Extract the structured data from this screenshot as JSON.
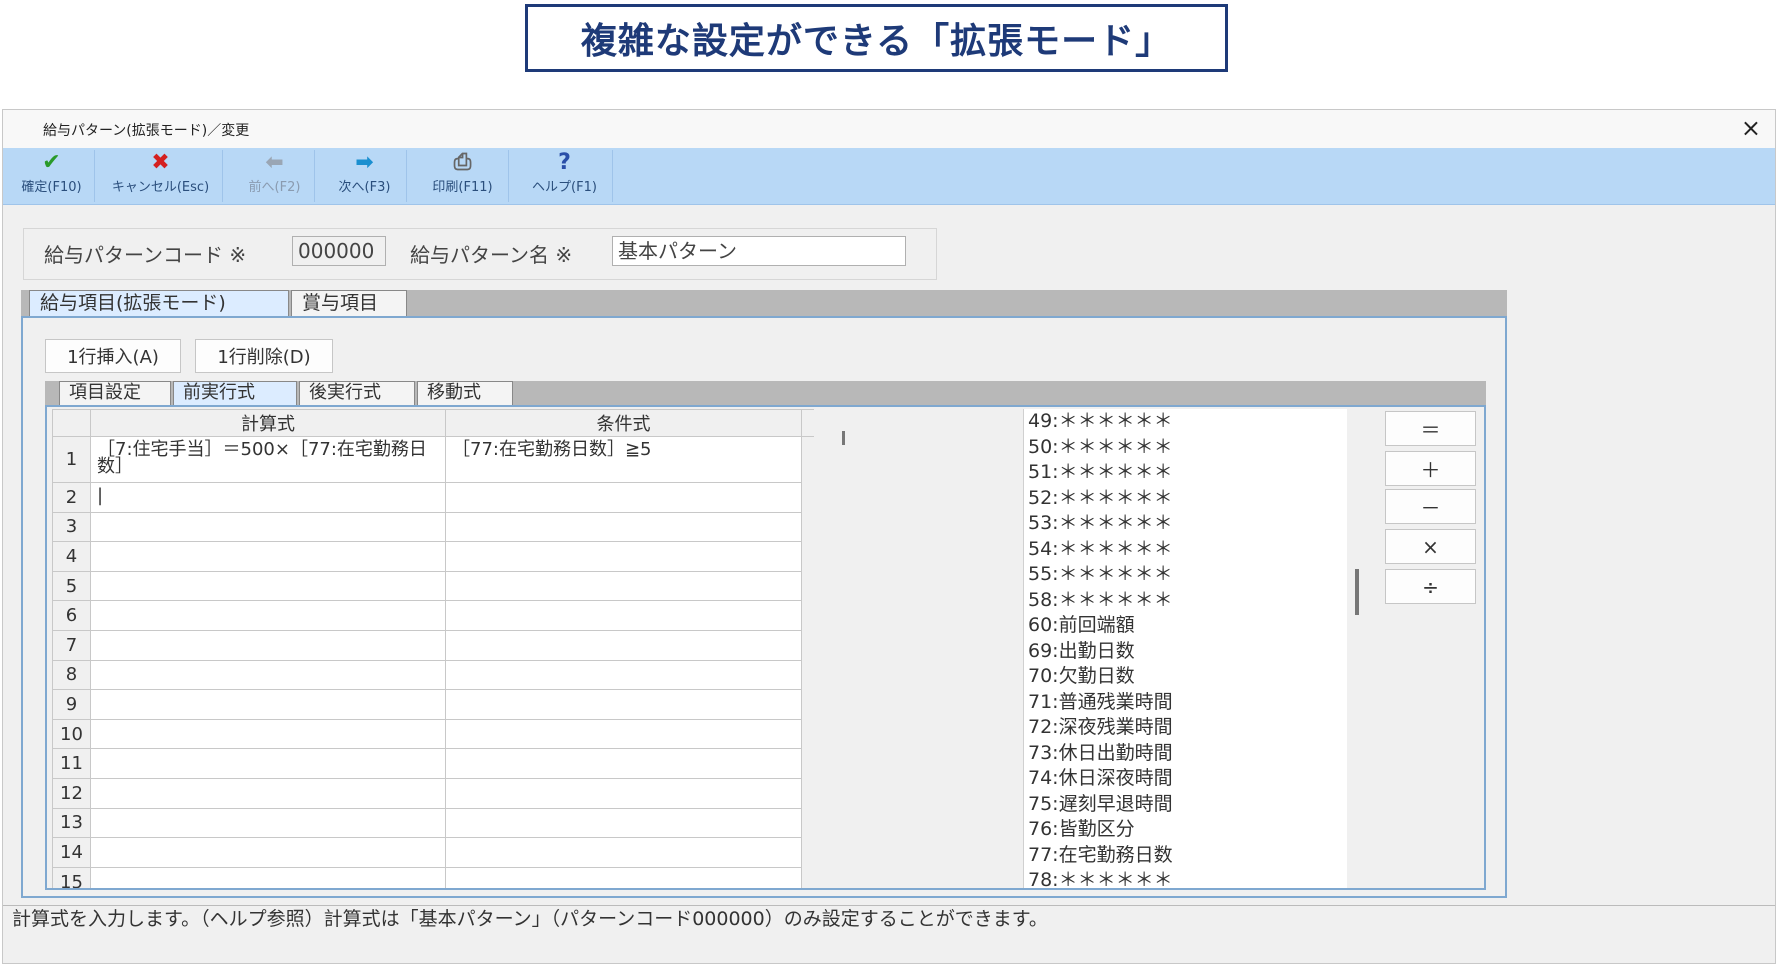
{
  "banner": {
    "text": "複雑な設定ができる「拡張モード」"
  },
  "window": {
    "title": "給与パターン(拡張モード)／変更",
    "close_glyph": "×"
  },
  "toolbar": {
    "confirm": {
      "icon": "✔",
      "label": "確定(F10)"
    },
    "cancel": {
      "icon": "✖",
      "label": "キャンセル(Esc)"
    },
    "prev": {
      "icon": "⬅",
      "label": "前へ(F2)"
    },
    "next": {
      "icon": "➡",
      "label": "次へ(F3)"
    },
    "print": {
      "icon": "⎙",
      "label": "印刷(F11)"
    },
    "help": {
      "icon": "?",
      "label": "ヘルプ(F1)"
    }
  },
  "header": {
    "code_label": "給与パターンコード ※",
    "code_value": "000000",
    "name_label": "給与パターン名 ※",
    "name_value": "基本パターン"
  },
  "outer_tabs": [
    "給与項目(拡張モード)",
    "賞与項目"
  ],
  "actions": {
    "insert_row": "1行挿入(A)",
    "delete_row": "1行削除(D)"
  },
  "inner_tabs": [
    "項目設定",
    "前実行式",
    "後実行式",
    "移動式"
  ],
  "grid": {
    "columns": [
      "計算式",
      "条件式"
    ],
    "rows": [
      {
        "no": "1",
        "formula": "［7:住宅手当］＝500×［77:在宅勤務日数］",
        "condition": "［77:在宅勤務日数］≧5"
      },
      {
        "no": "2",
        "formula": "|",
        "condition": ""
      },
      {
        "no": "3",
        "formula": "",
        "condition": ""
      },
      {
        "no": "4",
        "formula": "",
        "condition": ""
      },
      {
        "no": "5",
        "formula": "",
        "condition": ""
      },
      {
        "no": "6",
        "formula": "",
        "condition": ""
      },
      {
        "no": "7",
        "formula": "",
        "condition": ""
      },
      {
        "no": "8",
        "formula": "",
        "condition": ""
      },
      {
        "no": "9",
        "formula": "",
        "condition": ""
      },
      {
        "no": "10",
        "formula": "",
        "condition": ""
      },
      {
        "no": "11",
        "formula": "",
        "condition": ""
      },
      {
        "no": "12",
        "formula": "",
        "condition": ""
      },
      {
        "no": "13",
        "formula": "",
        "condition": ""
      },
      {
        "no": "14",
        "formula": "",
        "condition": ""
      },
      {
        "no": "15",
        "formula": "",
        "condition": ""
      }
    ]
  },
  "item_list": [
    "49:＊＊＊＊＊＊",
    "50:＊＊＊＊＊＊",
    "51:＊＊＊＊＊＊",
    "52:＊＊＊＊＊＊",
    "53:＊＊＊＊＊＊",
    "54:＊＊＊＊＊＊",
    "55:＊＊＊＊＊＊",
    "58:＊＊＊＊＊＊",
    "60:前回端額",
    "69:出勤日数",
    "70:欠勤日数",
    "71:普通残業時間",
    "72:深夜残業時間",
    "73:休日出勤時間",
    "74:休日深夜時間",
    "75:遅刻早退時間",
    "76:皆勤区分",
    "77:在宅勤務日数",
    "78:＊＊＊＊＊＊"
  ],
  "operators": [
    "＝",
    "＋",
    "－",
    "×",
    "÷"
  ],
  "status": "計算式を入力します。（ヘルプ参照）計算式は「基本パターン」（パターンコード000000）のみ設定することができます。"
}
